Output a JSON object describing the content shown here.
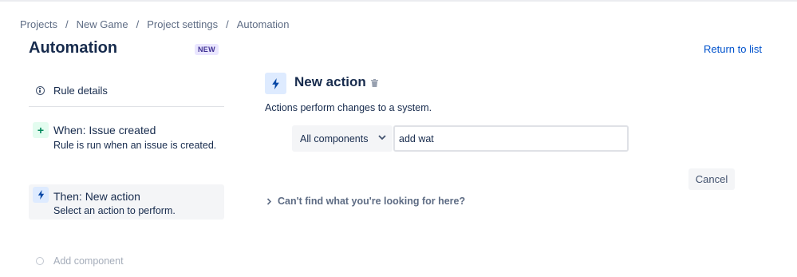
{
  "breadcrumb": {
    "items": [
      "Projects",
      "New Game",
      "Project settings",
      "Automation"
    ],
    "separator": "/"
  },
  "header": {
    "title": "Automation",
    "badge": "NEW",
    "return_link": "Return to list"
  },
  "sidebar": {
    "rule_details": {
      "label": "Rule details",
      "icon": "info-icon"
    },
    "trigger": {
      "title": "When: Issue created",
      "description": "Rule is run when an issue is created.",
      "icon": "plus-icon"
    },
    "action": {
      "title": "Then: New action",
      "description": "Select an action to perform.",
      "icon": "lightning-bolt-icon",
      "selected": true
    },
    "add_component": {
      "label": "Add component",
      "icon": "circle-icon"
    }
  },
  "panel": {
    "title": "New action",
    "icon": "lightning-bolt-icon",
    "description": "Actions perform changes to a system.",
    "filter": {
      "selected": "All components"
    },
    "search": {
      "value": "add wat"
    },
    "cancel_label": "Cancel",
    "help_toggle": "Can't find what you're looking for here?"
  },
  "colors": {
    "link": "#0052cc",
    "text": "#172b4d",
    "subtle_text": "#5e6c84",
    "trigger_bg": "#e3fcef",
    "action_bg": "#deebff",
    "badge_bg": "#eae6ff",
    "badge_text": "#403294"
  }
}
